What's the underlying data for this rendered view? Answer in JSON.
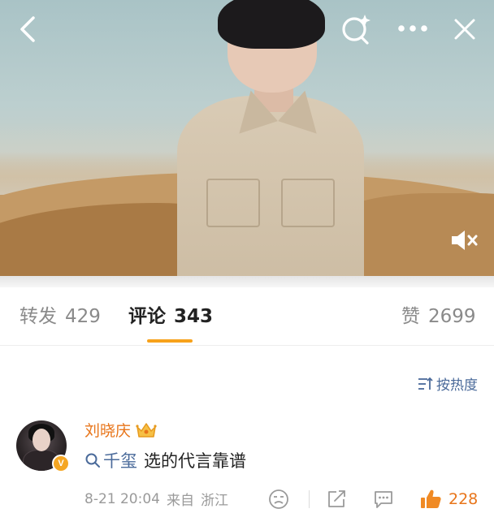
{
  "tabs": {
    "repost_label": "转发",
    "repost_count": "429",
    "comment_label": "评论",
    "comment_count": "343",
    "like_label": "赞",
    "like_count": "2699"
  },
  "sort": {
    "label": "按热度"
  },
  "comment": {
    "username": "刘晓庆",
    "topic": "千玺",
    "text": "选的代言靠谱",
    "timestamp": "8-21 20:04",
    "location_prefix": "来自",
    "location": "浙江",
    "likes": "228",
    "verified_badge": "V"
  },
  "colors": {
    "accent_orange": "#f7a21b",
    "username_orange": "#e8751a",
    "link_blue": "#4a6a9a"
  },
  "icons": [
    "back-icon",
    "search-sparkle-icon",
    "more-icon",
    "close-icon",
    "mute-icon",
    "sort-icon",
    "crown-icon",
    "search-icon",
    "dislike-face-icon",
    "share-icon",
    "reply-icon",
    "thumbs-up-icon"
  ]
}
